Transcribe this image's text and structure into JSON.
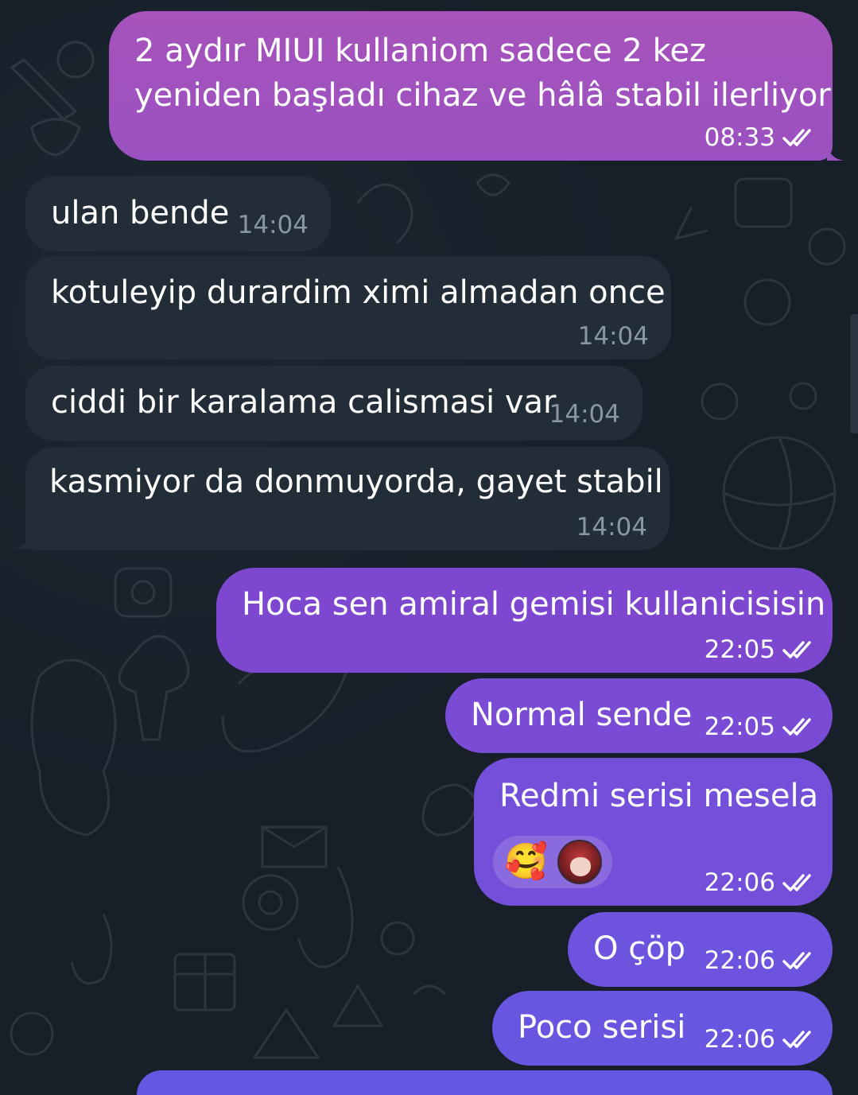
{
  "colors": {
    "background": "#172029",
    "incoming_bubble": "#222d38",
    "incoming_time": "#8a96a3",
    "outgoing_gradient": [
      "#9a4fbd",
      "#7d4cd3",
      "#6458e3"
    ]
  },
  "messages": [
    {
      "direction": "out",
      "lines": [
        "2 aydır MIUI kullaniom sadece 2 kez",
        "yeniden başladı cihaz ve hâlâ stabil ilerliyor"
      ],
      "time": "08:33",
      "status": "read"
    },
    {
      "direction": "in",
      "text": "ulan bende",
      "time": "14:04"
    },
    {
      "direction": "in",
      "text": "kotuleyip durardim ximi almadan once",
      "time": "14:04"
    },
    {
      "direction": "in",
      "text": "ciddi bir karalama calismasi var",
      "time": "14:04"
    },
    {
      "direction": "in",
      "text": "kasmiyor da donmuyorda, gayet stabil",
      "time": "14:04"
    },
    {
      "direction": "out",
      "text": "Hoca sen amiral gemisi kullanicisisin",
      "time": "22:05",
      "status": "read"
    },
    {
      "direction": "out",
      "text": "Normal sende",
      "time": "22:05",
      "status": "read"
    },
    {
      "direction": "out",
      "text": "Redmi serisi mesela",
      "time": "22:06",
      "status": "read",
      "reaction": {
        "emoji": "🥰",
        "reactor_avatar": "avatar"
      }
    },
    {
      "direction": "out",
      "text": "O çöp",
      "time": "22:06",
      "status": "read"
    },
    {
      "direction": "out",
      "text": "Poco serisi",
      "time": "22:06",
      "status": "read"
    }
  ]
}
